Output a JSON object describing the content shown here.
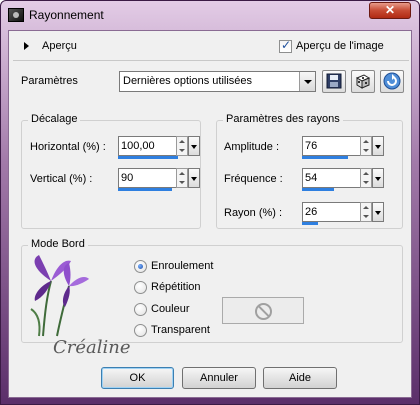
{
  "window": {
    "title": "Rayonnement",
    "close_label": "✕"
  },
  "preview": {
    "label": "Aperçu",
    "image_preview_label": "Aperçu de l'image",
    "image_preview_checked": true
  },
  "presets": {
    "label": "Paramètres",
    "value": "Dernières options utilisées"
  },
  "offset": {
    "legend": "Décalage",
    "horizontal": {
      "label": "Horizontal (%) :",
      "value": "100,00",
      "level": 1.0
    },
    "vertical": {
      "label": "Vertical (%) :",
      "value": "90",
      "level": 0.9
    }
  },
  "rays": {
    "legend": "Paramètres des rayons",
    "amplitude": {
      "label": "Amplitude :",
      "value": "76",
      "level": 0.76
    },
    "frequency": {
      "label": "Fréquence :",
      "value": "54",
      "level": 0.54
    },
    "radius": {
      "label": "Rayon (%) :",
      "value": "26",
      "level": 0.26
    }
  },
  "edge_mode": {
    "legend": "Mode Bord",
    "options": [
      "Enroulement",
      "Répétition",
      "Couleur",
      "Transparent"
    ],
    "selected": "Enroulement"
  },
  "watermark": {
    "text": "Créaline"
  },
  "buttons": {
    "ok": "OK",
    "cancel": "Annuler",
    "help": "Aide"
  },
  "colors": {
    "accent_bar": "#2e7fe0",
    "title_gradient_top": "#e3cce6",
    "title_gradient_bottom": "#5b2f6a"
  },
  "icons": {
    "save": "floppy-disk-icon",
    "random": "dice-icon",
    "reset": "reset-arrow-icon",
    "no_color": "no-entry-icon",
    "flower": "iris-flower-icon"
  }
}
